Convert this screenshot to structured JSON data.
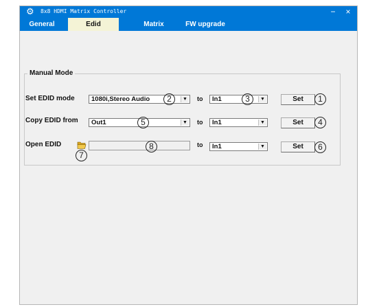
{
  "window": {
    "title": "8x8 HDMI Matrix Controller",
    "minimize": "−",
    "close": "×",
    "icon": "gear-icon"
  },
  "tabs": [
    {
      "label": "General",
      "active": false
    },
    {
      "label": "Edid",
      "active": true
    },
    {
      "label": "Matrix",
      "active": false
    },
    {
      "label": "FW upgrade",
      "active": false
    }
  ],
  "manual_mode": {
    "title": "Manual Mode",
    "to_label": "to",
    "rows": [
      {
        "label": "Set EDID mode",
        "source_value": "1080i,Stereo Audio",
        "target_value": "In1",
        "button": "Set"
      },
      {
        "label": "Copy EDID from",
        "source_value": "Out1",
        "target_value": "In1",
        "button": "Set"
      },
      {
        "label": "Open EDID",
        "source_value": "",
        "target_value": "In1",
        "button": "Set",
        "icon": "folder-open-icon"
      }
    ]
  },
  "callouts": [
    "1",
    "2",
    "3",
    "4",
    "5",
    "6",
    "7",
    "8"
  ],
  "colors": {
    "titlebar": "#0078d7",
    "active_tab": "#f4f3d6",
    "window_bg": "#f0f0f0"
  }
}
